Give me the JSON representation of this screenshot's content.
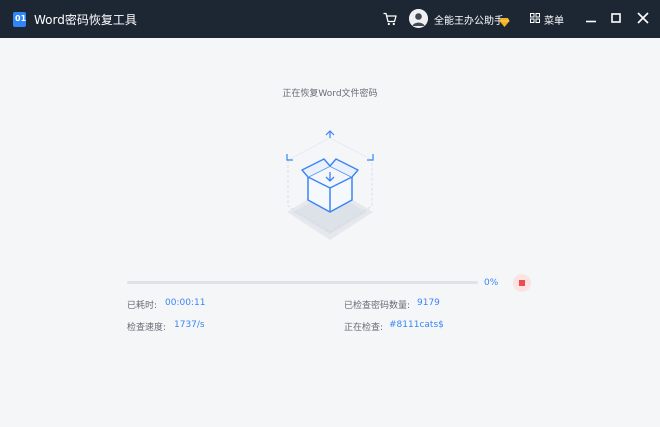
{
  "app": {
    "logo_text": "01",
    "title": "Word密码恢复工具"
  },
  "user": {
    "name": "全能王办公助手"
  },
  "menu": {
    "label": "菜单"
  },
  "main": {
    "status_text": "正在恢复Word文件密码",
    "progress": {
      "value": 0,
      "percent_text": "0%"
    },
    "stats": {
      "elapsed_label": "已耗时:",
      "elapsed_value": "00:00:11",
      "checked_label": "已检查密码数量:",
      "checked_value": "9179",
      "speed_label": "检查速度:",
      "speed_value": "1737/s",
      "current_label": "正在检查:",
      "current_value": "#8111cats$"
    }
  },
  "colors": {
    "titlebar": "#1d2633",
    "accent": "#3a85f5",
    "stop": "#ef4b4b",
    "background": "#f5f6f8"
  },
  "icons": [
    "app-logo-icon",
    "cart-icon",
    "avatar",
    "vip-diamond-icon",
    "grid-menu-icon",
    "minimize-icon",
    "maximize-icon",
    "close-icon",
    "box-illustration",
    "stop-icon"
  ]
}
